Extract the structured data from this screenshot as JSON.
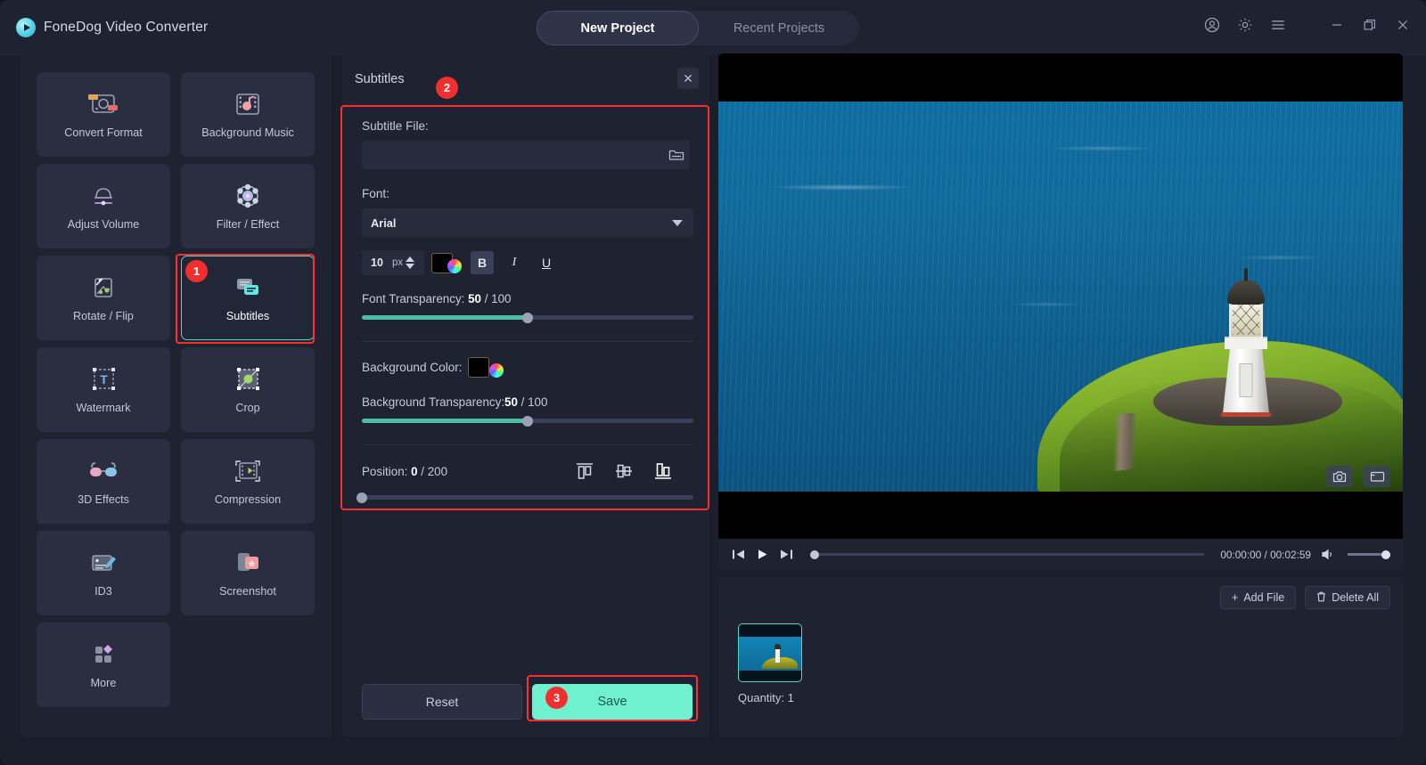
{
  "app": {
    "brand": "FoneDog Video Converter",
    "logo_icon": "play-circle-icon"
  },
  "titlebar": {
    "tabs": [
      {
        "label": "New Project",
        "active": true
      },
      {
        "label": "Recent Projects",
        "active": false
      }
    ],
    "window_icons": [
      "account-icon",
      "gear-icon",
      "menu-icon",
      "minimize-icon",
      "restore-icon",
      "close-icon"
    ]
  },
  "tools": [
    {
      "label": "Convert Format",
      "icon": "convert-format-icon",
      "active": false
    },
    {
      "label": "Background Music",
      "icon": "background-music-icon",
      "active": false
    },
    {
      "label": "Adjust Volume",
      "icon": "adjust-volume-icon",
      "active": false
    },
    {
      "label": "Filter / Effect",
      "icon": "filter-effect-icon",
      "active": false
    },
    {
      "label": "Rotate / Flip",
      "icon": "rotate-flip-icon",
      "active": false
    },
    {
      "label": "Subtitles",
      "icon": "subtitles-icon",
      "active": true
    },
    {
      "label": "Watermark",
      "icon": "watermark-icon",
      "active": false
    },
    {
      "label": "Crop",
      "icon": "crop-icon",
      "active": false
    },
    {
      "label": "3D Effects",
      "icon": "3d-effects-icon",
      "active": false
    },
    {
      "label": "Compression",
      "icon": "compression-icon",
      "active": false
    },
    {
      "label": "ID3",
      "icon": "id3-icon",
      "active": false
    },
    {
      "label": "Screenshot",
      "icon": "screenshot-icon",
      "active": false
    },
    {
      "label": "More",
      "icon": "more-icon",
      "active": false
    }
  ],
  "subtitles_panel": {
    "title": "Subtitles",
    "close_label": "✕",
    "subtitle_file": {
      "label": "Subtitle File:",
      "value": "",
      "placeholder": "",
      "browse_icon": "folder-icon"
    },
    "font": {
      "label": "Font:",
      "value": "Arial",
      "size": "10",
      "size_unit": "px",
      "color": "#000000",
      "bold_label": "B",
      "italic_label": "I",
      "underline_label": "U",
      "bold_active": true
    },
    "font_transparency": {
      "label_prefix": "Font Transparency: ",
      "value": "50",
      "label_suffix": " / 100",
      "percent": 50
    },
    "background_color": {
      "label": "Background Color:",
      "color": "#000000"
    },
    "background_transparency": {
      "label_prefix": "Background Transparency:",
      "value": "50",
      "label_suffix": " / 100",
      "percent": 50
    },
    "position": {
      "label_prefix": "Position: ",
      "value": "0",
      "label_suffix": " / 200",
      "percent": 0,
      "align_options": [
        "align-top-icon",
        "align-middle-icon",
        "align-bottom-icon"
      ],
      "align_selected": "align-bottom-icon"
    },
    "reset_label": "Reset",
    "save_label": "Save"
  },
  "player": {
    "current_time": "00:00:00",
    "total_time": "00:02:59",
    "timecode": "00:00:00 / 00:02:59",
    "overlay_icons": [
      "camera-icon",
      "fullscreen-icon"
    ],
    "control_icons": [
      "previous-icon",
      "play-icon",
      "next-icon",
      "volume-icon"
    ],
    "progress_percent": 0,
    "volume_percent": 100
  },
  "filelist": {
    "add_file_label": "Add File",
    "delete_all_label": "Delete All",
    "add_icon": "plus-icon",
    "delete_icon": "trash-icon",
    "quantity_label": "Quantity: 1"
  },
  "annotations": {
    "badges": [
      {
        "number": "1",
        "target": "subtitles-tool-tile"
      },
      {
        "number": "2",
        "target": "subtitles-settings-area"
      },
      {
        "number": "3",
        "target": "save-button"
      }
    ],
    "highlight_color": "#ff2d2d"
  },
  "colors": {
    "accent_teal": "#4fd6c4",
    "save_green": "#6ff0cf",
    "badge_red": "#f03030",
    "panel_bg": "#1f2230",
    "tile_bg": "#2a2e40"
  }
}
